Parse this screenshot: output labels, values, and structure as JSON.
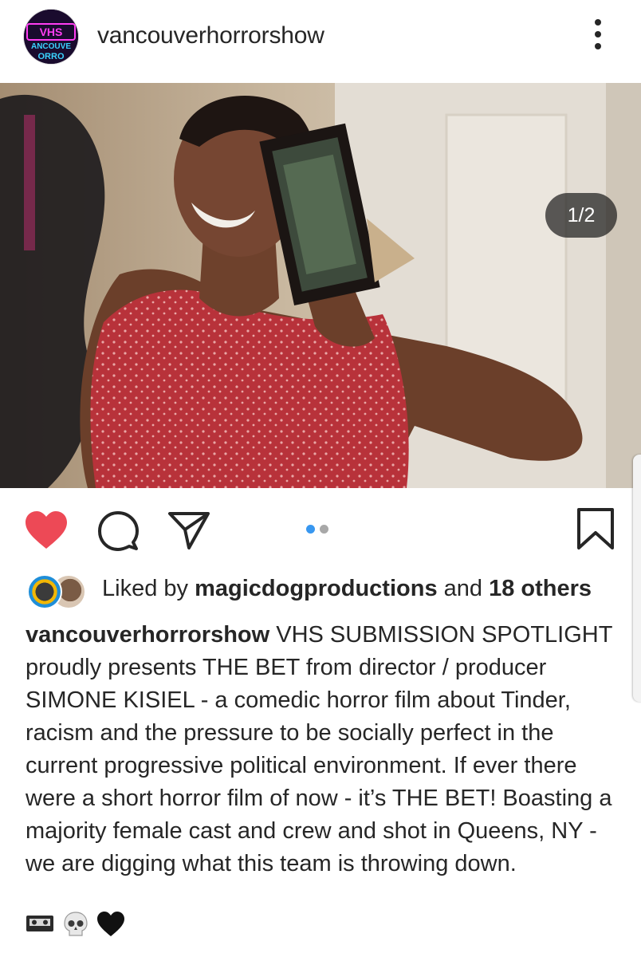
{
  "header": {
    "avatar_text_top": "VHS",
    "avatar_text_bottom": "ANCOUVE",
    "avatar_text_bottom2": "ORRO",
    "username": "vancouverhorrorshow"
  },
  "post": {
    "counter": "1/2",
    "carousel_current": 1,
    "carousel_total": 2,
    "liked": true
  },
  "likes": {
    "prefix": "Liked by ",
    "user": "magicdogproductions",
    "middle": " and ",
    "others": "18 others"
  },
  "caption": {
    "username": "vancouverhorrorshow",
    "text": " VHS SUBMISSION SPOTLIGHT proudly presents THE BET from director / producer SIMONE KISIEL - a comedic horror film about Tinder, racism and the pressure to be socially perfect in the current progressive political environment. If ever there were a short horror film of now - it’s THE BET! Boasting a majority female cast and crew and shot in Queens, NY - we are digging what this team is throwing down.",
    "emojis": [
      "videocassette-emoji",
      "skull-emoji",
      "black-heart-emoji"
    ]
  },
  "colors": {
    "like_red": "#ed4956",
    "active_dot": "#3897f0",
    "inactive_dot": "#a8a8a8",
    "text": "#262626",
    "avatar_neon": "#ff3df2"
  },
  "icons": {
    "more": "more-vertical-icon",
    "like": "heart-filled-icon",
    "comment": "comment-icon",
    "share": "paper-plane-icon",
    "save": "bookmark-icon",
    "tag": "person-icon"
  }
}
